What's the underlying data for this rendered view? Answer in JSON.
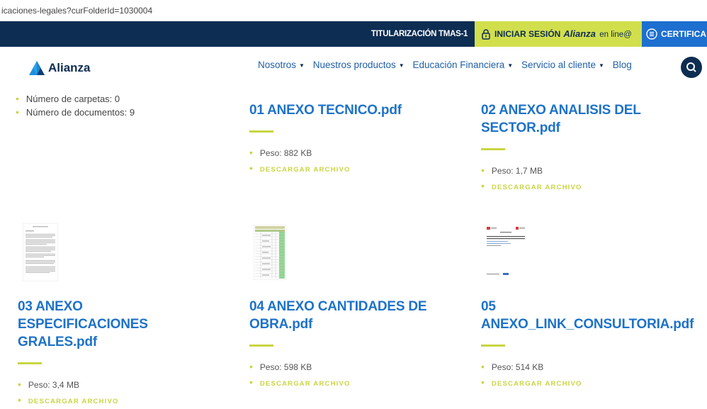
{
  "browser": {
    "url": "icaciones-legales?curFolderId=1030004"
  },
  "topbar": {
    "titularizacion": "TITULARIZACIÓN TMAS-1",
    "login_label": "INICIAR SESIÓN",
    "login_brand": "Alianza",
    "login_online": "en line@",
    "cert_label": "CERTIFICA"
  },
  "header": {
    "logo_text": "Alianza",
    "nav": [
      {
        "label": "Nosotros"
      },
      {
        "label": "Nuestros productos"
      },
      {
        "label": "Educación Financiera"
      },
      {
        "label": "Servicio al cliente"
      },
      {
        "label": "Blog"
      }
    ]
  },
  "folder": {
    "carpetas": "Número de carpetas: 0",
    "documentos": "Número de documentos: 9"
  },
  "documents": [
    {
      "title": "01 ANEXO TECNICO.pdf",
      "size": "Peso: 882 KB",
      "download": "DESCARGAR ARCHIVO"
    },
    {
      "title": "02 ANEXO ANALISIS DEL SECTOR.pdf",
      "size": "Peso: 1,7 MB",
      "download": "DESCARGAR ARCHIVO"
    },
    {
      "title": "03 ANEXO ESPECIFICACIONES GRALES.pdf",
      "size": "Peso: 3,4 MB",
      "download": "DESCARGAR ARCHIVO"
    },
    {
      "title": "04 ANEXO CANTIDADES DE OBRA.pdf",
      "size": "Peso: 598 KB",
      "download": "DESCARGAR ARCHIVO"
    },
    {
      "title": "05 ANEXO_LINK_CONSULTORIA.pdf",
      "size": "Peso: 514 KB",
      "download": "DESCARGAR ARCHIVO"
    }
  ],
  "colors": {
    "navy": "#0d2d52",
    "lime": "#d2df4c",
    "blue": "#1d72c9"
  }
}
